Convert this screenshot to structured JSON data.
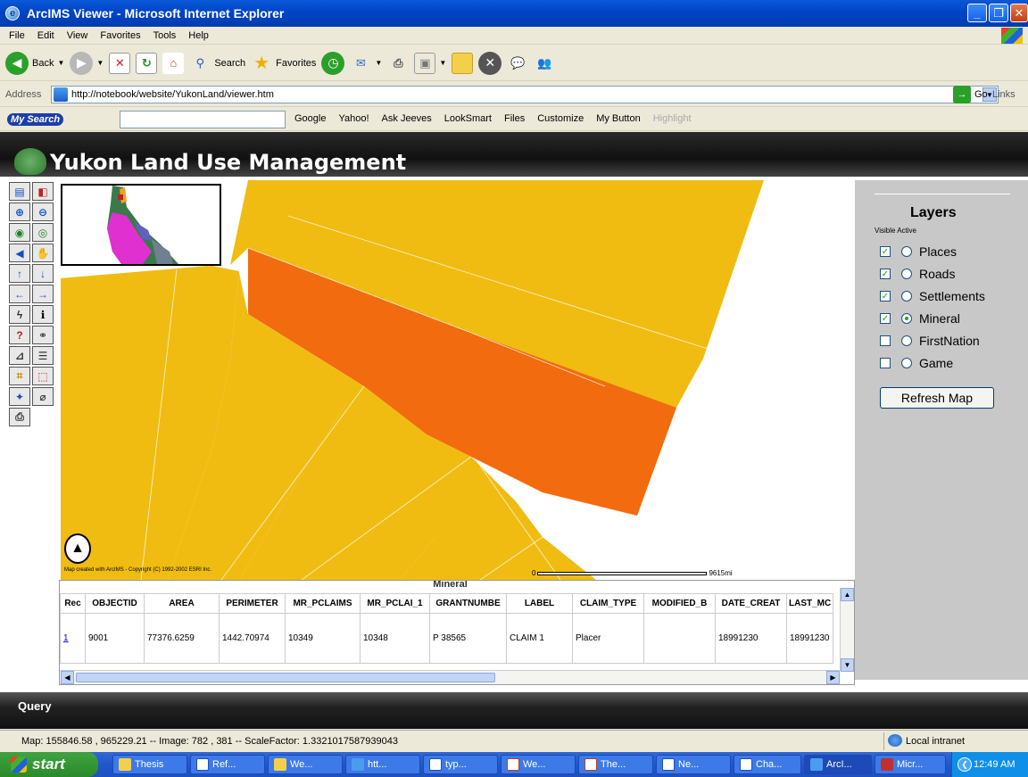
{
  "window": {
    "title": "ArcIMS Viewer - Microsoft Internet Explorer"
  },
  "menu": [
    "File",
    "Edit",
    "View",
    "Favorites",
    "Tools",
    "Help"
  ],
  "toolbar": {
    "back": "Back",
    "search": "Search",
    "favorites": "Favorites"
  },
  "address": {
    "label": "Address",
    "url": "http://notebook/website/YukonLand/viewer.htm",
    "go": "Go",
    "links": "Links"
  },
  "searchbar": {
    "brand": "Search",
    "items": [
      "Google",
      "Yahoo!",
      "Ask Jeeves",
      "LookSmart",
      "Files",
      "Customize",
      "My Button",
      "Highlight"
    ]
  },
  "app": {
    "title": "Yukon Land Use Management"
  },
  "map": {
    "credit": "Map created with ArcIMS - Copyright (C) 1992-2002 ESRI Inc.",
    "scale_start": "0",
    "scale_end": "9615mi"
  },
  "layers": {
    "title": "Layers",
    "header": "Visible Active",
    "items": [
      {
        "name": "Places",
        "visible": true,
        "active": false
      },
      {
        "name": "Roads",
        "visible": true,
        "active": false
      },
      {
        "name": "Settlements",
        "visible": true,
        "active": false
      },
      {
        "name": "Mineral",
        "visible": true,
        "active": true
      },
      {
        "name": "FirstNation",
        "visible": false,
        "active": false
      },
      {
        "name": "Game",
        "visible": false,
        "active": false
      }
    ],
    "refresh": "Refresh Map"
  },
  "table": {
    "title": "Mineral",
    "columns": [
      "Rec",
      "OBJECTID",
      "AREA",
      "PERIMETER",
      "MR_PCLAIMS",
      "MR_PCLAI_1",
      "GRANTNUMBE",
      "LABEL",
      "CLAIM_TYPE",
      "MODIFIED_B",
      "DATE_CREAT",
      "LAST_MC"
    ],
    "rows": [
      [
        "1",
        "9001",
        "77376.6259",
        "1442.70974",
        "10349",
        "10348",
        "P 38565",
        "CLAIM 1",
        "Placer",
        "",
        "18991230",
        "18991230"
      ]
    ]
  },
  "query": "Query",
  "status": {
    "text": "Map: 155846.58 , 965229.21 -- Image: 782 , 381 -- ScaleFactor: 1.3321017587939043",
    "zone": "Local intranet"
  },
  "taskbar": {
    "start": "start",
    "tasks": [
      "Thesis",
      "Ref...",
      "We...",
      "htt...",
      "typ...",
      "We...",
      "The...",
      "Ne...",
      "Cha...",
      "ArcI...",
      "Micr..."
    ],
    "clock": "12:49 AM"
  },
  "colors": {
    "claim_yellow": "#f0bc12",
    "claim_orange": "#f26b0f",
    "titlebar": "#0a58d8",
    "panel": "#c8c8c8"
  }
}
